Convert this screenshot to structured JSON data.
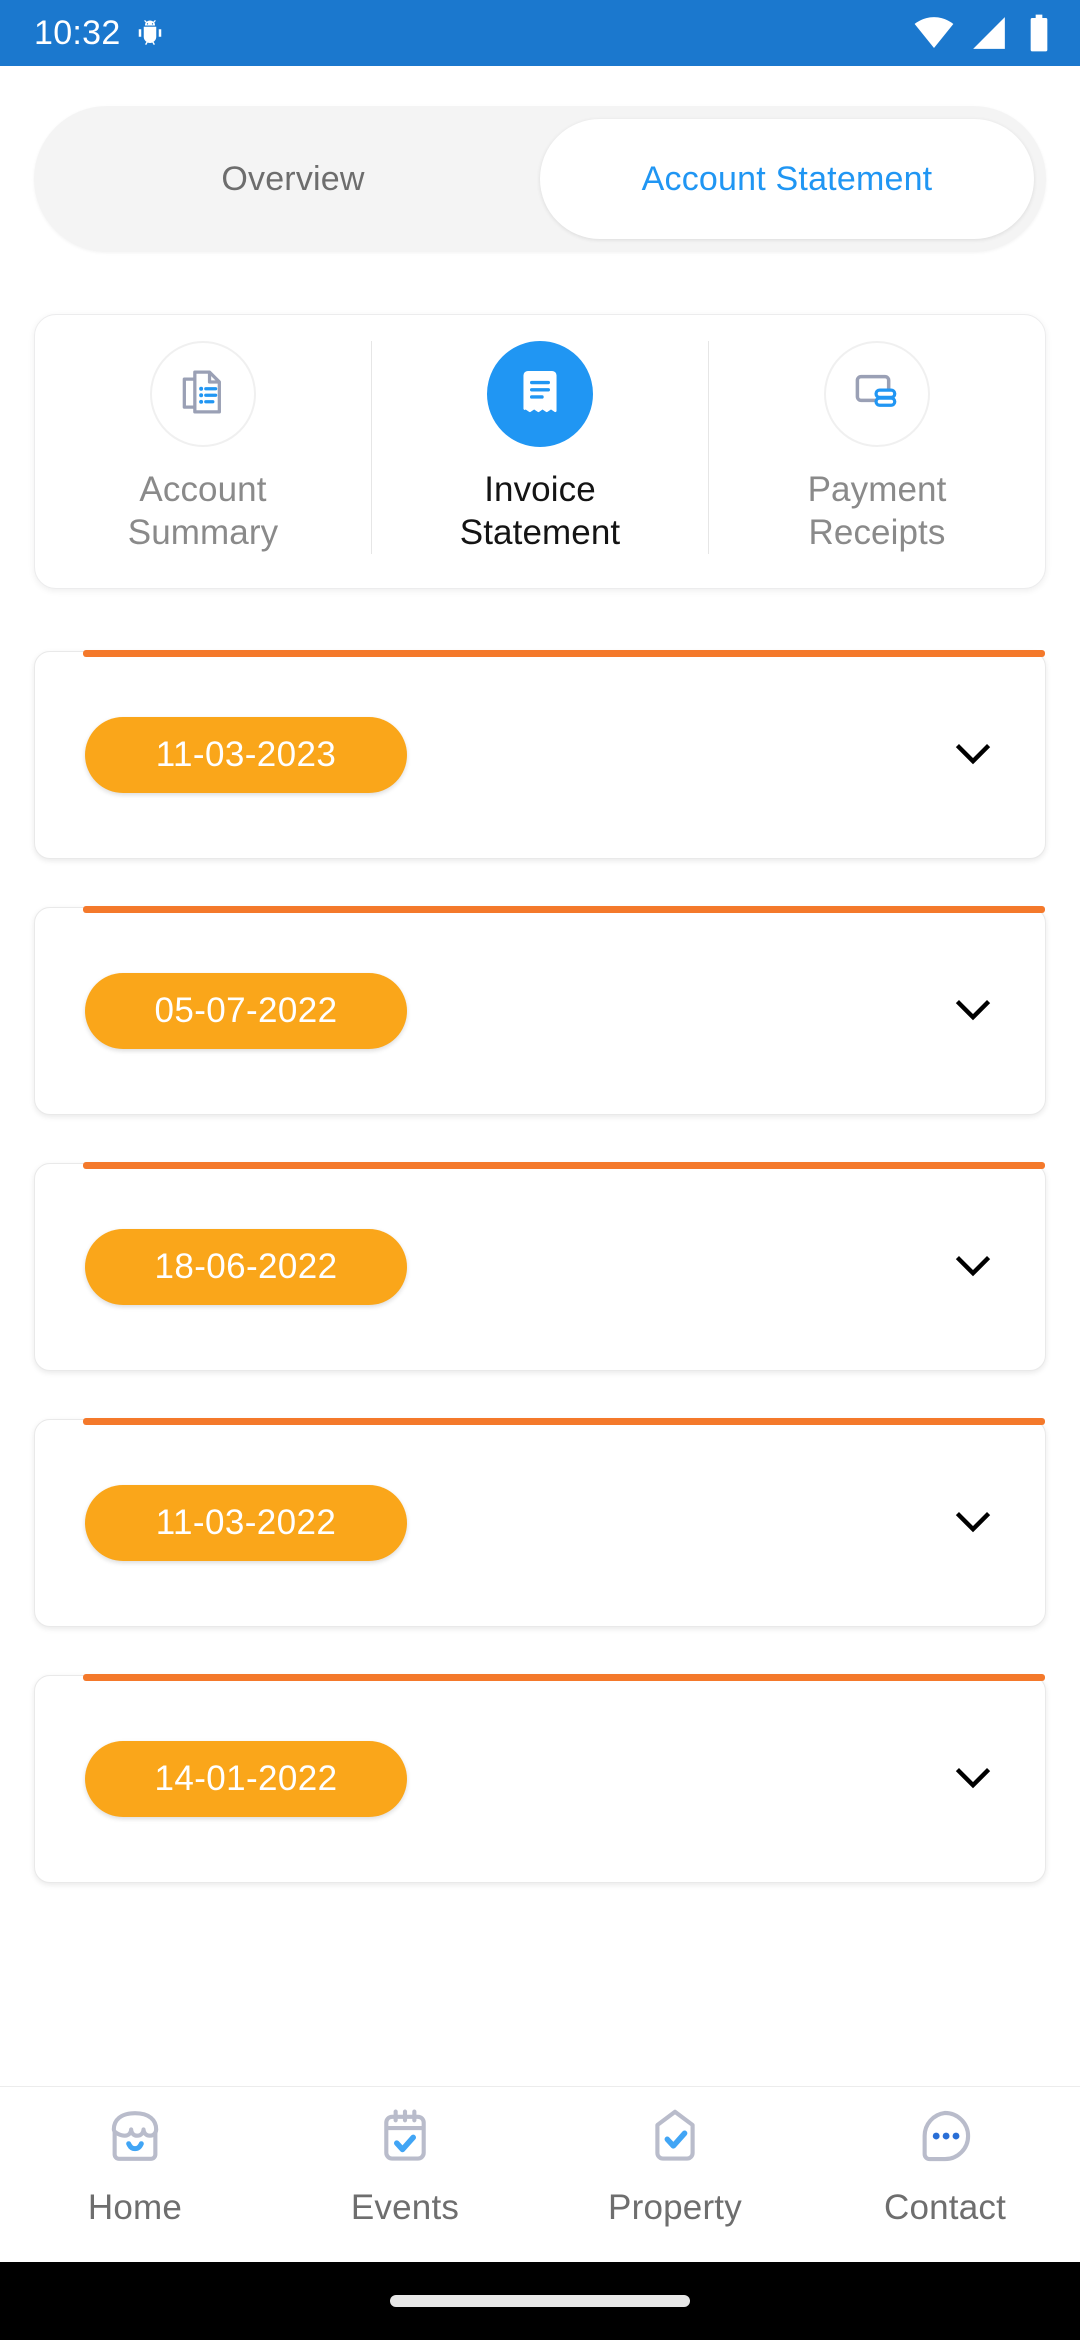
{
  "status_bar": {
    "clock": "10:32",
    "icons": [
      "android-bug-icon",
      "wifi-icon",
      "cellular-signal-icon",
      "battery-icon"
    ],
    "background_color": "#1b78ce"
  },
  "segmented_control": {
    "tabs": [
      {
        "label": "Overview",
        "active": false
      },
      {
        "label": "Account Statement",
        "active": true
      }
    ],
    "active_color": "#2096f3",
    "inactive_color": "#6d6d6d"
  },
  "categories": {
    "items": [
      {
        "label_line1": "Account",
        "label_line2": "Summary",
        "icon": "documents-list-icon",
        "active": false
      },
      {
        "label_line1": "Invoice",
        "label_line2": "Statement",
        "icon": "receipt-icon",
        "active": true
      },
      {
        "label_line1": "Payment",
        "label_line2": "Receipts",
        "icon": "card-coins-icon",
        "active": false
      }
    ],
    "active_circle_color": "#2096f3"
  },
  "invoice_list": {
    "top_bar_color": "#f4792b",
    "pill_color": "#faa61a",
    "expand_icon": "chevron-down-icon",
    "items": [
      {
        "date": "11-03-2023"
      },
      {
        "date": "05-07-2022"
      },
      {
        "date": "18-06-2022"
      },
      {
        "date": "11-03-2022"
      },
      {
        "date": "14-01-2022"
      }
    ]
  },
  "bottom_nav": {
    "items": [
      {
        "label": "Home",
        "icon": "storefront-icon"
      },
      {
        "label": "Events",
        "icon": "calendar-check-icon"
      },
      {
        "label": "Property",
        "icon": "house-check-icon"
      },
      {
        "label": "Contact",
        "icon": "chat-ellipsis-icon"
      }
    ],
    "label_color": "#6e6e6e",
    "accent_color": "#41a5f5"
  },
  "gesture_bar": {
    "background_color": "#000000",
    "handle_color": "#e8e8e8"
  }
}
